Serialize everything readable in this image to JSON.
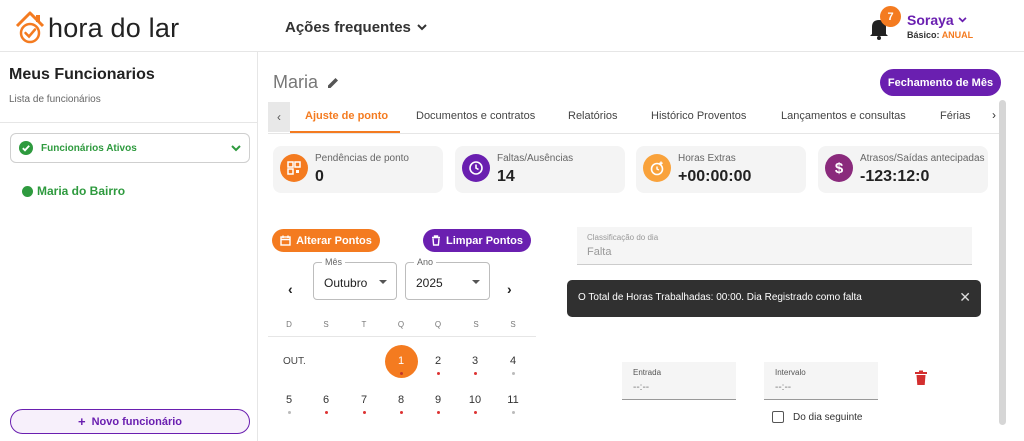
{
  "header": {
    "logo_text": "hora do lar",
    "quick_actions": "Ações frequentes",
    "notifications": "7",
    "user_name": "Soraya",
    "plan_label": "Básico:",
    "plan_value": "ANUAL"
  },
  "sidebar": {
    "title": "Meus Funcionarios",
    "subtitle": "Lista de funcionários",
    "filter": "Funcionários Ativos",
    "employees": [
      "Maria do Bairro"
    ],
    "new_button": "Novo funcionário"
  },
  "main": {
    "employee_name": "Maria",
    "close_month_button": "Fechamento de Mês",
    "tabs": [
      "Ajuste de ponto",
      "Documentos e contratos",
      "Relatórios",
      "Histórico Proventos",
      "Lançamentos e consultas",
      "Férias"
    ],
    "active_tab": 0,
    "stats": [
      {
        "label": "Pendências de ponto",
        "value": "0",
        "color": "#f47b20",
        "icon": "qr-grid-icon"
      },
      {
        "label": "Faltas/Ausências",
        "value": "14",
        "color": "#6a1fb0",
        "icon": "clock-icon"
      },
      {
        "label": "Horas Extras",
        "value": "+00:00:00",
        "color": "#f9a23b",
        "icon": "clock-plus-icon"
      },
      {
        "label": "Atrasos/Saídas antecipadas",
        "value": "-123:12:0",
        "color": "#8a2a7c",
        "icon": "dollar-icon"
      }
    ],
    "alter_button": "Alterar Pontos",
    "clear_button": "Limpar Pontos",
    "month_label": "Mês",
    "month_value": "Outubro",
    "year_label": "Ano",
    "year_value": "2025",
    "weekdays": [
      "D",
      "S",
      "T",
      "Q",
      "Q",
      "S",
      "S"
    ],
    "month_abbrev": "OUT.",
    "week1": [
      "1",
      "2",
      "3",
      "4"
    ],
    "week2": [
      "5",
      "6",
      "7",
      "8",
      "9",
      "10",
      "11"
    ],
    "classification_label": "Classificação do dia",
    "classification_value": "Falta",
    "toast": "O Total de Horas Trabalhadas: 00:00. Dia Registrado como falta",
    "entrada_label": "Entrada",
    "entrada_value": "--:--",
    "intervalo_label": "Intervalo",
    "intervalo_value": "--:--",
    "next_day_label": "Do dia seguinte"
  }
}
